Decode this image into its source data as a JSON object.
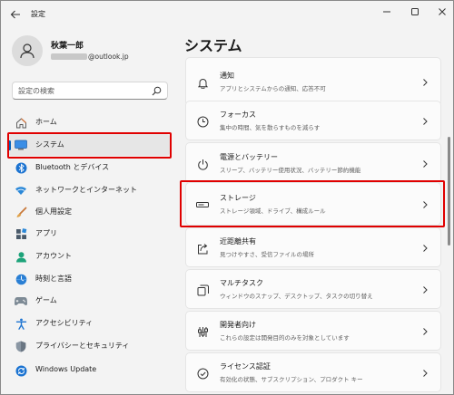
{
  "window": {
    "title": "設定"
  },
  "profile": {
    "name": "秋葉一郎",
    "email_suffix": "@outlook.jp"
  },
  "search": {
    "placeholder": "設定の検索"
  },
  "sidebar": {
    "items": [
      {
        "label": "ホーム",
        "icon": "home-icon"
      },
      {
        "label": "システム",
        "icon": "system-icon"
      },
      {
        "label": "Bluetooth とデバイス",
        "icon": "bluetooth-icon"
      },
      {
        "label": "ネットワークとインターネット",
        "icon": "network-icon"
      },
      {
        "label": "個人用設定",
        "icon": "brush-icon"
      },
      {
        "label": "アプリ",
        "icon": "apps-icon"
      },
      {
        "label": "アカウント",
        "icon": "account-icon"
      },
      {
        "label": "時刻と言語",
        "icon": "time-language-icon"
      },
      {
        "label": "ゲーム",
        "icon": "gaming-icon"
      },
      {
        "label": "アクセシビリティ",
        "icon": "accessibility-icon"
      },
      {
        "label": "プライバシーとセキュリティ",
        "icon": "shield-icon"
      },
      {
        "label": "Windows Update",
        "icon": "update-icon"
      }
    ]
  },
  "main": {
    "title": "システム",
    "cards": [
      {
        "title": "通知",
        "desc": "アプリとシステムからの通知、応答不可",
        "icon": "bell-icon"
      },
      {
        "title": "フォーカス",
        "desc": "集中の時間、気を散らすものを減らす",
        "icon": "focus-icon"
      },
      {
        "title": "電源とバッテリー",
        "desc": "スリープ、バッテリー使用状況、バッテリー節約機能",
        "icon": "power-icon"
      },
      {
        "title": "ストレージ",
        "desc": "ストレージ領域、ドライブ、構成ルール",
        "icon": "storage-icon"
      },
      {
        "title": "近距離共有",
        "desc": "見つけやすさ、受信ファイルの場所",
        "icon": "share-icon"
      },
      {
        "title": "マルチタスク",
        "desc": "ウィンドウのスナップ、デスクトップ、タスクの切り替え",
        "icon": "multitask-icon"
      },
      {
        "title": "開発者向け",
        "desc": "これらの設定は開発目的のみを対象としています",
        "icon": "developer-icon"
      },
      {
        "title": "ライセンス認証",
        "desc": "有効化の状態、サブスクリプション、プロダクト キー",
        "icon": "activation-icon"
      }
    ]
  },
  "colors": {
    "accent": "#005fb8",
    "highlight": "#e00000"
  }
}
